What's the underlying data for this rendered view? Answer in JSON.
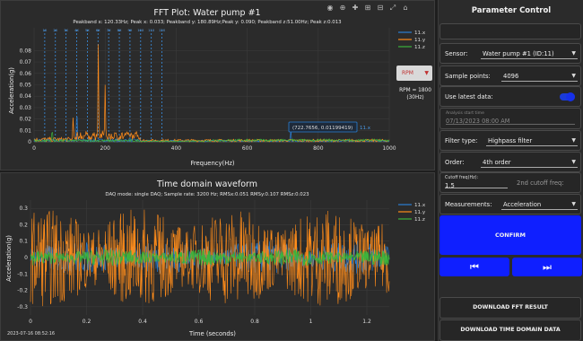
{
  "fft": {
    "title": "FFT Plot: Water pump #1",
    "subtitle": "Peakband x: 120.33Hz; Peak x: 0.033; Peakband y: 180.89Hz;Peak y: 0.090; Peakband z:51.00Hz; Peak z:0.013",
    "xlabel": "Frequency(Hz)",
    "ylabel": "Acceleration(g)",
    "annotation": "(722.7656, 0.01199419)",
    "annotation_series": "11.x",
    "band_labels": [
      "1X",
      "2X",
      "3X",
      "4X",
      "5X",
      "6X",
      "7X",
      "8X",
      "9X",
      "10X",
      "11X",
      "12X"
    ]
  },
  "rpm": {
    "select_label": "RPM",
    "value_text": "RPM = 1800",
    "hz_text": "(30Hz)"
  },
  "time": {
    "title": "Time domain waveform",
    "subtitle": "DAQ mode: single DAQ; Sample rate: 3200 Hz; RMSx:0.051 RMSy:0.107 RMSz:0.023",
    "xlabel": "Time (seconds)",
    "ylabel": "Acceleration(g)",
    "start": "2023-07-16 08:52:16"
  },
  "chart_data": [
    {
      "type": "line",
      "title": "FFT Plot: Water pump #1",
      "xlabel": "Frequency(Hz)",
      "ylabel": "Acceleration(g)",
      "xlim": [
        0,
        1000
      ],
      "ylim": [
        0,
        0.1
      ],
      "x_ticks": [
        0,
        200,
        400,
        600,
        800,
        1000
      ],
      "y_ticks": [
        0,
        0.01,
        0.02,
        0.03,
        0.04,
        0.05,
        0.06,
        0.07,
        0.08
      ],
      "y_tick_labels": [
        "0",
        "0.01",
        "0.02",
        "0.03",
        "0.04",
        "0.05",
        "0.06",
        "0.07",
        "0.08"
      ],
      "legend_position": "top-right",
      "series": [
        {
          "name": "11.x",
          "color": "#2a7fd4",
          "peaks": [
            [
              120.33,
              0.033
            ],
            [
              722.77,
              0.012
            ]
          ]
        },
        {
          "name": "11.y",
          "color": "#ff8c1a",
          "peaks": [
            [
              180.89,
              0.09
            ],
            [
              200,
              0.05
            ],
            [
              110,
              0.025
            ]
          ]
        },
        {
          "name": "11.z",
          "color": "#3cb43c",
          "peaks": [
            [
              51.0,
              0.013
            ]
          ]
        }
      ],
      "harmonic_markers_hz": [
        30,
        60,
        90,
        120,
        150,
        180,
        210,
        240,
        270,
        300,
        330,
        360
      ]
    },
    {
      "type": "line",
      "title": "Time domain waveform",
      "xlabel": "Time (seconds)",
      "ylabel": "Acceleration(g)",
      "xlim": [
        0,
        1.28
      ],
      "ylim": [
        -0.35,
        0.35
      ],
      "x_ticks": [
        0,
        0.2,
        0.4,
        0.6,
        0.8,
        1,
        1.2
      ],
      "y_ticks": [
        -0.3,
        -0.2,
        -0.1,
        0,
        0.1,
        0.2,
        0.3
      ],
      "y_tick_labels": [
        "-0.3",
        "-0.2",
        "-0.1",
        "0",
        "0.1",
        "0.2",
        "0.3"
      ],
      "legend_position": "top-right",
      "series": [
        {
          "name": "11.x",
          "color": "#2a7fd4",
          "amplitude": 0.1
        },
        {
          "name": "11.y",
          "color": "#ff8c1a",
          "amplitude": 0.3
        },
        {
          "name": "11.z",
          "color": "#3cb43c",
          "amplitude": 0.05
        }
      ]
    }
  ],
  "sidebar": {
    "title": "Parameter Control",
    "sensor_label": "Sensor:",
    "sensor_value": "Water pump #1 (ID:11)",
    "sample_label": "Sample points:",
    "sample_value": "4096",
    "latest_label": "Use latest data:",
    "latest_on": true,
    "analysis_label": "Analysis start time",
    "analysis_value": "07/13/2023 08:00 AM",
    "filter_label": "Filter type:",
    "filter_value": "Highpass filter",
    "order_label": "Order:",
    "order_value": "4th order",
    "cutoff_label": "Cutoff freq(Hz):",
    "cutoff_value": "1.5",
    "cutoff2_placeholder": "2nd cutoff freq:",
    "measure_label": "Measurements:",
    "measure_value": "Acceleration",
    "confirm_label": "CONFIRM",
    "prev_icon": "⏮",
    "next_icon": "⏭",
    "download_fft": "DOWNLOAD FFT RESULT",
    "download_time": "DOWNLOAD TIME DOMAIN DATA"
  },
  "toolbar_icons": [
    "camera-icon",
    "zoom-icon",
    "pan-icon",
    "zoom-in-icon",
    "zoom-out-icon",
    "autoscale-icon",
    "reset-icon"
  ]
}
